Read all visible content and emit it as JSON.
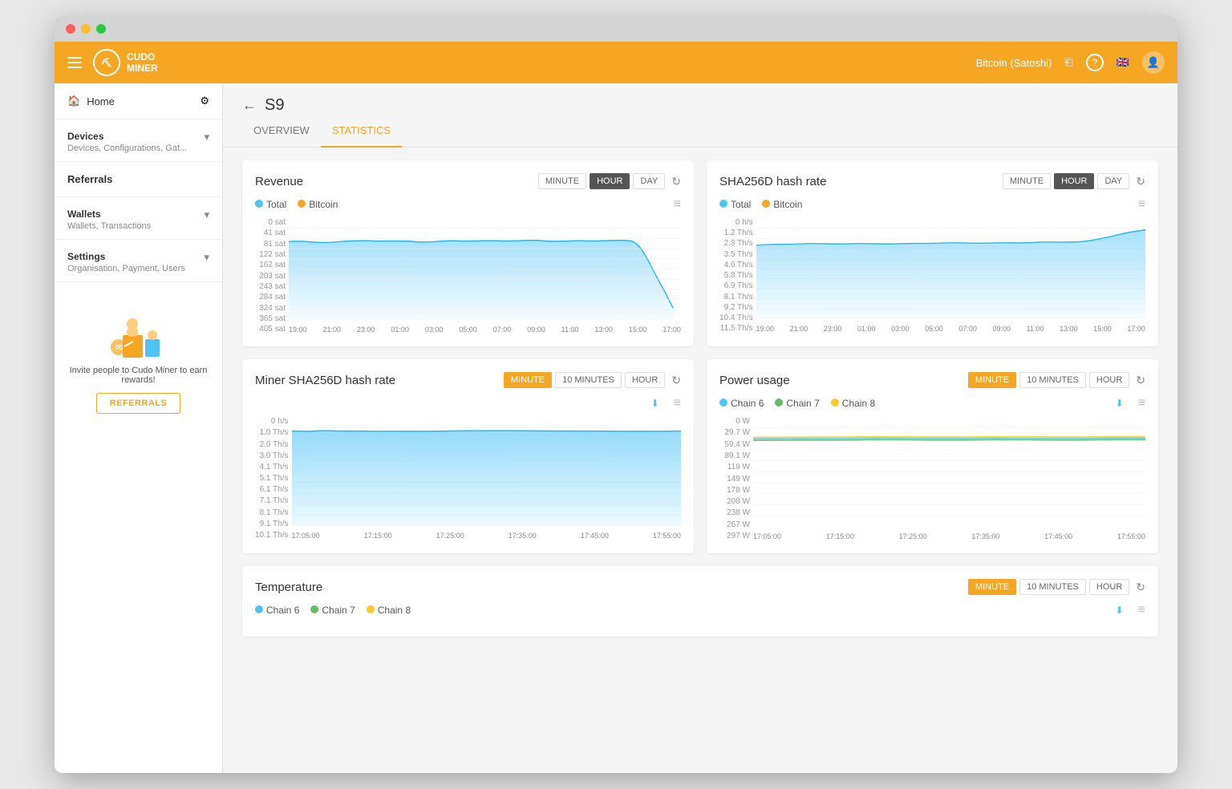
{
  "window": {
    "title": "Cudo Miner"
  },
  "topnav": {
    "logo_text": "CUDO\nMINER",
    "currency": "Bitcoin (Satoshi)",
    "share_icon": "share-icon",
    "help_icon": "help-icon",
    "flag_icon": "flag-icon",
    "user_icon": "user-icon"
  },
  "sidebar": {
    "home_label": "Home",
    "settings_icon": "gear-icon",
    "devices_label": "Devices",
    "devices_sub": "Devices, Configurations, Gat...",
    "referrals_label": "Referrals",
    "wallets_label": "Wallets",
    "wallets_sub": "Wallets, Transactions",
    "settings_label": "Settings",
    "settings_sub": "Organisation, Payment, Users",
    "invite_text": "Invite people to Cudo Miner to earn rewards!",
    "referrals_btn": "REFERRALS"
  },
  "page": {
    "back_label": "←",
    "title": "S9",
    "tabs": [
      "OVERVIEW",
      "STATISTICS"
    ],
    "active_tab": "STATISTICS"
  },
  "charts": {
    "revenue": {
      "title": "Revenue",
      "controls": [
        "MINUTE",
        "HOUR",
        "DAY"
      ],
      "active_control": "HOUR",
      "legend": [
        {
          "label": "Total",
          "color": "#4fc3f7"
        },
        {
          "label": "Bitcoin",
          "color": "#f5a623"
        }
      ],
      "y_labels": [
        "405 sat",
        "365 sat",
        "324 sat",
        "284 sat",
        "243 sat",
        "203 sat",
        "162 sat",
        "122 sat",
        "81 sat",
        "41 sat",
        "0 sat"
      ],
      "x_labels": [
        "19:00",
        "21:00",
        "23:00",
        "01:00",
        "03:00",
        "05:00",
        "07:00",
        "09:00",
        "11:00",
        "13:00",
        "15:00",
        "17:00"
      ]
    },
    "sha256d": {
      "title": "SHA256D hash rate",
      "controls": [
        "MINUTE",
        "HOUR",
        "DAY"
      ],
      "active_control": "HOUR",
      "legend": [
        {
          "label": "Total",
          "color": "#4fc3f7"
        },
        {
          "label": "Bitcoin",
          "color": "#f5a623"
        }
      ],
      "y_labels": [
        "11.5 Th/s",
        "10.4 Th/s",
        "9.2 Th/s",
        "8.1 Th/s",
        "6.9 Th/s",
        "5.8 Th/s",
        "4.6 Th/s",
        "3.5 Th/s",
        "2.3 Th/s",
        "1.2 Th/s",
        "0 h/s"
      ],
      "x_labels": [
        "19:00",
        "21:00",
        "23:00",
        "01:00",
        "03:00",
        "05:00",
        "07:00",
        "09:00",
        "11:00",
        "13:00",
        "15:00",
        "17:00"
      ]
    },
    "miner_hashrate": {
      "title": "Miner SHA256D hash rate",
      "controls": [
        "MINUTE",
        "10 MINUTES",
        "HOUR"
      ],
      "active_control": "MINUTE",
      "legend": [],
      "y_labels": [
        "10.1 Th/s",
        "9.1 Th/s",
        "8.1 Th/s",
        "7.1 Th/s",
        "6.1 Th/s",
        "5.1 Th/s",
        "4.1 Th/s",
        "3.0 Th/s",
        "2.0 Th/s",
        "1.0 Th/s",
        "0 h/s"
      ],
      "x_labels": [
        "17:05:00",
        "17:15:00",
        "17:25:00",
        "17:35:00",
        "17:45:00",
        "17:55:00"
      ]
    },
    "power_usage": {
      "title": "Power usage",
      "controls": [
        "MINUTE",
        "10 MINUTES",
        "HOUR"
      ],
      "active_control": "MINUTE",
      "legend": [
        {
          "label": "Chain 6",
          "color": "#4fc3f7"
        },
        {
          "label": "Chain 7",
          "color": "#66bb6a"
        },
        {
          "label": "Chain 8",
          "color": "#ffca28"
        }
      ],
      "y_labels": [
        "297 W",
        "267 W",
        "238 W",
        "208 W",
        "178 W",
        "149 W",
        "119 W",
        "89.1 W",
        "59.4 W",
        "29.7 W",
        "0 W"
      ],
      "x_labels": [
        "17:05:00",
        "17:15:00",
        "17:25:00",
        "17:35:00",
        "17:45:00",
        "17:55:00"
      ]
    },
    "temperature": {
      "title": "Temperature",
      "controls": [
        "MINUTE",
        "10 MINUTES",
        "HOUR"
      ],
      "active_control": "MINUTE",
      "legend": [
        {
          "label": "Chain 6",
          "color": "#4fc3f7"
        },
        {
          "label": "Chain 7",
          "color": "#66bb6a"
        },
        {
          "label": "Chain 8",
          "color": "#ffca28"
        }
      ]
    }
  }
}
